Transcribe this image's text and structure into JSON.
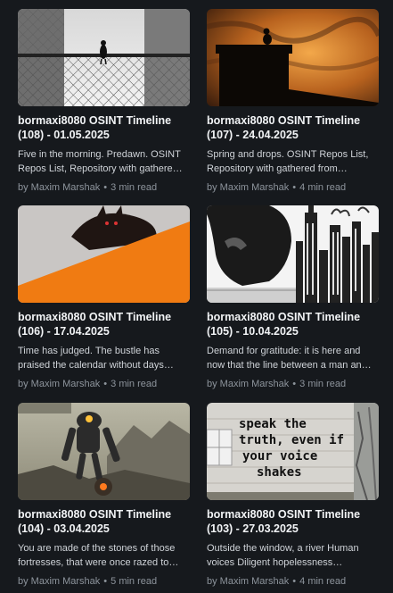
{
  "cards": [
    {
      "title_line1": "bormaxi8080 OSINT Timeline",
      "title_line2": "(108) - 01.05.2025",
      "description": "Five in the morning. Predawn. OSINT Repos List, Repository with gathere…",
      "author": "by Maxim Marshak",
      "separator": "•",
      "read_time": "3 min read",
      "image": "bird-on-fence-image"
    },
    {
      "title_line1": "bormaxi8080 OSINT Timeline",
      "title_line2": "(107) - 24.04.2025",
      "description": "Spring and drops. OSINT Repos List, Repository with gathered from…",
      "author": "by Maxim Marshak",
      "separator": "•",
      "read_time": "4 min read",
      "image": "bird-on-roof-sunset-image"
    },
    {
      "title_line1": "bormaxi8080 OSINT Timeline",
      "title_line2": "(106) - 17.04.2025",
      "description": "Time has judged. The bustle has praised the calendar without days…",
      "author": "by Maxim Marshak",
      "separator": "•",
      "read_time": "3 min read",
      "image": "cat-orange-diagonal-image"
    },
    {
      "title_line1": "bormaxi8080 OSINT Timeline",
      "title_line2": "(105) - 10.04.2025",
      "description": "Demand for gratitude: it is here and now that the line between a man an…",
      "author": "by Maxim Marshak",
      "separator": "•",
      "read_time": "3 min read",
      "image": "man-city-sketch-image"
    },
    {
      "title_line1": "bormaxi8080 OSINT Timeline",
      "title_line2": "(104) - 03.04.2025",
      "description": "You are made of the stones of those fortresses, that were once razed to…",
      "author": "by Maxim Marshak",
      "separator": "•",
      "read_time": "5 min read",
      "image": "robot-landscape-image"
    },
    {
      "title_line1": "bormaxi8080 OSINT Timeline",
      "title_line2": "(103) - 27.03.2025",
      "description": "Outside the window, a river Human voices Diligent hopelessness…",
      "author": "by Maxim Marshak",
      "separator": "•",
      "read_time": "4 min read",
      "image": "graffiti-wall-image",
      "image_text": [
        "speak the",
        "truth, even if",
        "your voice",
        "shakes"
      ]
    }
  ]
}
